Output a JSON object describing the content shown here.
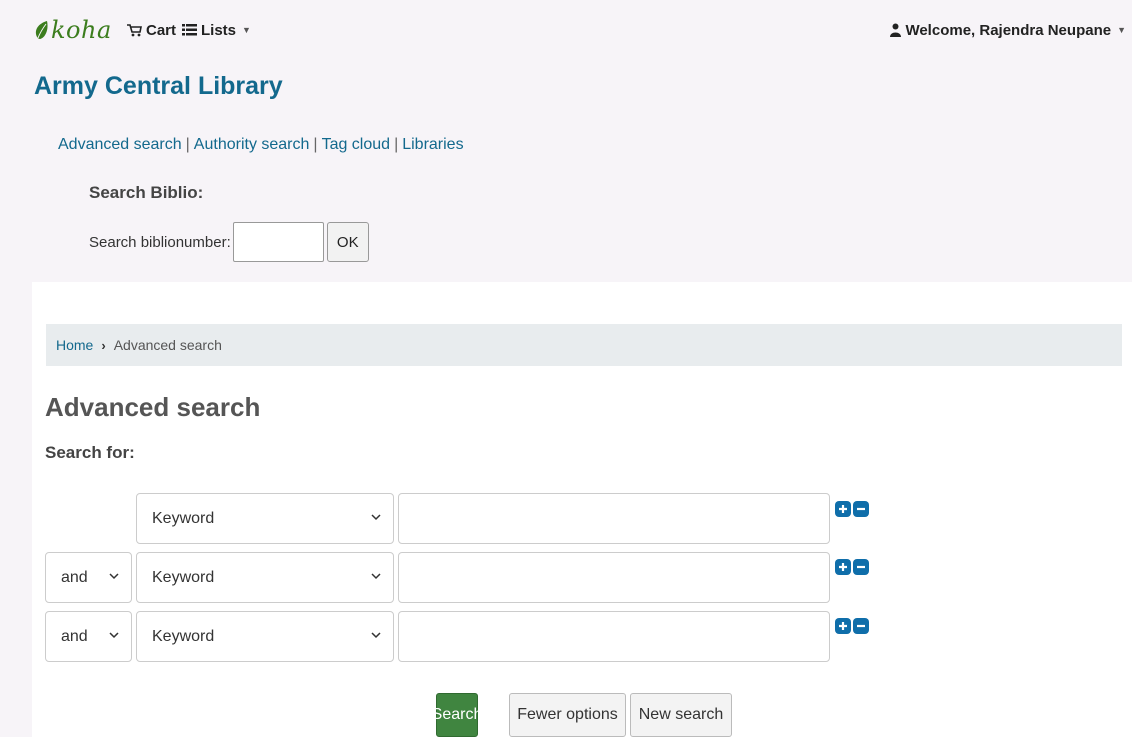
{
  "header": {
    "logo_text": "koha",
    "cart_label": "Cart",
    "lists_label": "Lists",
    "welcome_text": "Welcome, Rajendra Neupane"
  },
  "library_name": "Army Central Library",
  "quicklinks": [
    "Advanced search",
    "Authority search",
    "Tag cloud",
    "Libraries"
  ],
  "biblio_search": {
    "title": "Search Biblio:",
    "label": "Search biblionumber:",
    "value": "",
    "button_label": "OK"
  },
  "breadcrumb": {
    "home": "Home",
    "current": "Advanced search"
  },
  "page_title": "Advanced search",
  "search_for_label": "Search for:",
  "search_rows": [
    {
      "operator": "",
      "field": "Keyword",
      "term": ""
    },
    {
      "operator": "and",
      "field": "Keyword",
      "term": ""
    },
    {
      "operator": "and",
      "field": "Keyword",
      "term": ""
    }
  ],
  "buttons": {
    "search": "Search",
    "fewer_options": "Fewer options",
    "new_search": "New search"
  },
  "colors": {
    "link": "#13698d",
    "search_button": "#408540",
    "add_remove_icons": "#0f6eaa",
    "logo": "#3c7d1e"
  }
}
